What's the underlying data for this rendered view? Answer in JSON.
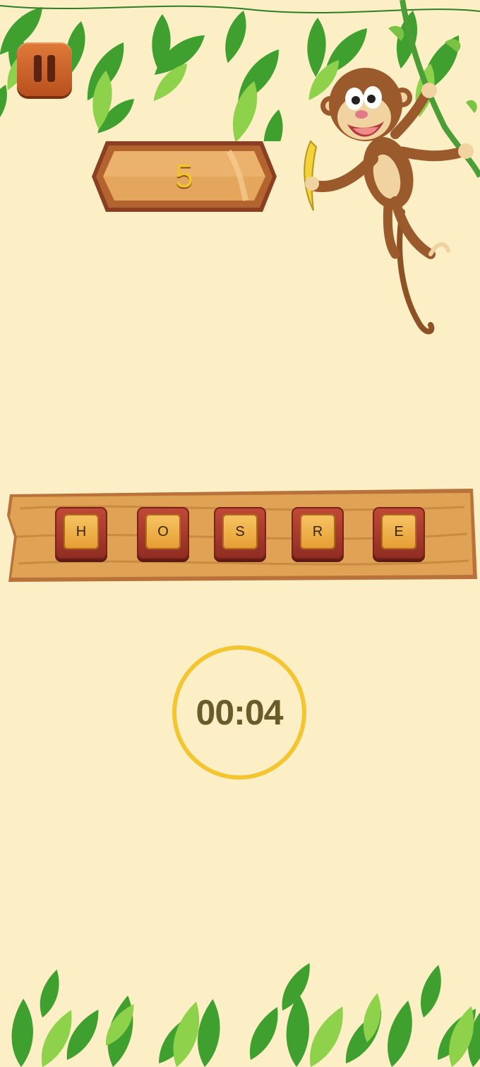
{
  "score": {
    "value": "5"
  },
  "word": {
    "letters": [
      "H",
      "O",
      "S",
      "R",
      "E"
    ]
  },
  "timer": {
    "display": "00:04"
  },
  "pause": {
    "icon": "pause-icon"
  },
  "colors": {
    "background": "#fcefc6",
    "leaf_dark": "#3ea22f",
    "leaf_light": "#8fd14a",
    "wood": "#d9994c",
    "tile_frame": "#a23a2c",
    "tile_face": "#f0b54a",
    "score_digit": "#f2c42e",
    "timer_ring": "#f2c531",
    "timer_text": "#6b5a2a"
  }
}
